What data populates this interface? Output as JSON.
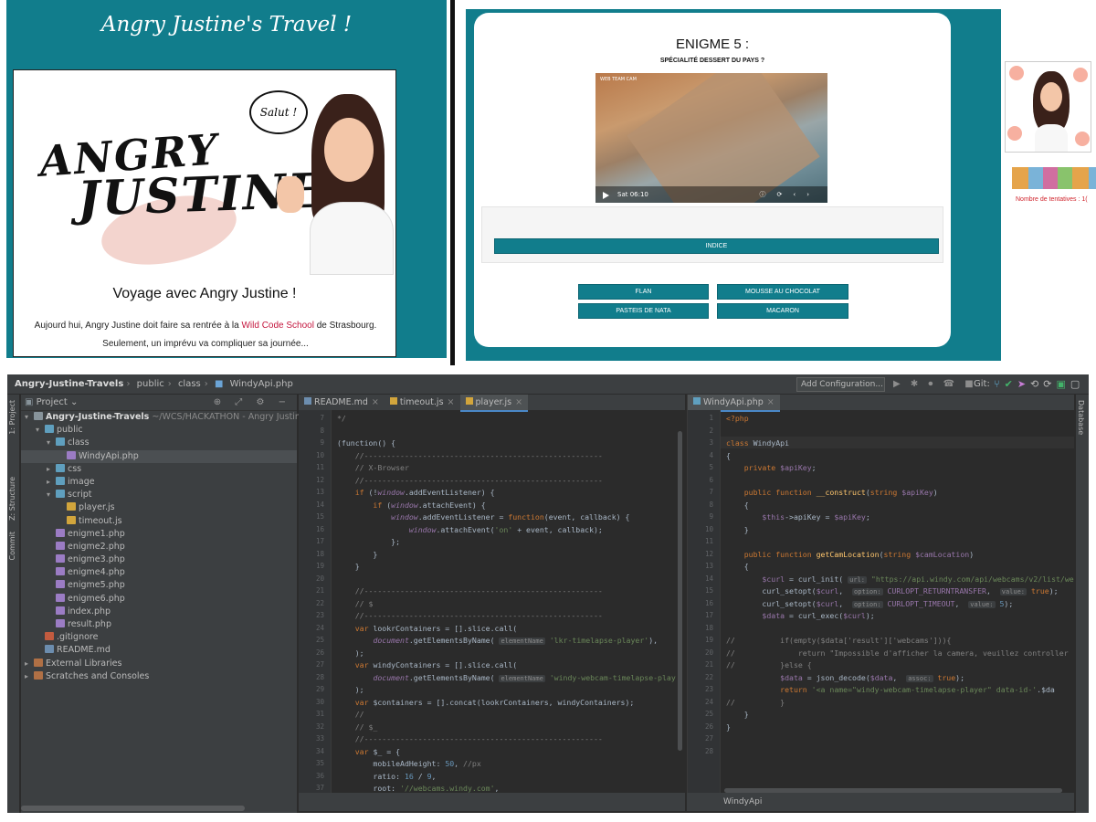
{
  "travel": {
    "title": "Angry Justine's Travel !",
    "logo_line1": "ANGRY",
    "logo_line2": "JUSTINE",
    "bubble": "Salut !",
    "heading": "Voyage avec Angry Justine !",
    "p1_a": "Aujourd hui, Angry Justine doit faire sa rentrée à la ",
    "p1_link": "Wild Code School",
    "p1_b": " de Strasbourg.",
    "p2": "Seulement, un imprévu va compliquer sa journée..."
  },
  "enigma": {
    "title": "ENIGME 5 :",
    "subtitle": "SPÉCIALITÉ DESSERT DU PAYS ?",
    "video_tag": "WEB TEAM CAM",
    "video_time": "Sat 06:10",
    "hint_button": "INDICE",
    "answers": [
      "FLAN",
      "MOUSSE AU CHOCOLAT",
      "PASTEIS DE NATA",
      "MACARON"
    ]
  },
  "sidebar": {
    "attempts": "Nombre de tentatives : 1("
  },
  "ide": {
    "breadcrumb": [
      "Angry-Justine-Travels",
      "public",
      "class",
      "WindyApi.php"
    ],
    "add_configuration": "Add Configuration...",
    "git_label": "Git:",
    "left_tabs": [
      "1: Project",
      "Z: Structure",
      "Commit"
    ],
    "right_tab": "Database",
    "project_header": "Project",
    "tree": [
      {
        "label": "Angry-Justine-Travels",
        "suffix": "~/WCS/HACKATHON - Angry Justine/An",
        "depth": 0,
        "arrow": "▾",
        "icon": "folder",
        "bold": true
      },
      {
        "label": "public",
        "depth": 1,
        "arrow": "▾",
        "icon": "folderb"
      },
      {
        "label": "class",
        "depth": 2,
        "arrow": "▾",
        "icon": "folderb"
      },
      {
        "label": "WindyApi.php",
        "depth": 3,
        "arrow": "",
        "icon": "php",
        "selected": true
      },
      {
        "label": "css",
        "depth": 2,
        "arrow": "▸",
        "icon": "folderb"
      },
      {
        "label": "image",
        "depth": 2,
        "arrow": "▸",
        "icon": "folderb"
      },
      {
        "label": "script",
        "depth": 2,
        "arrow": "▾",
        "icon": "folderb"
      },
      {
        "label": "player.js",
        "depth": 3,
        "arrow": "",
        "icon": "js"
      },
      {
        "label": "timeout.js",
        "depth": 3,
        "arrow": "",
        "icon": "js"
      },
      {
        "label": "enigme1.php",
        "depth": 2,
        "arrow": "",
        "icon": "php"
      },
      {
        "label": "enigme2.php",
        "depth": 2,
        "arrow": "",
        "icon": "php"
      },
      {
        "label": "enigme3.php",
        "depth": 2,
        "arrow": "",
        "icon": "php"
      },
      {
        "label": "enigme4.php",
        "depth": 2,
        "arrow": "",
        "icon": "php"
      },
      {
        "label": "enigme5.php",
        "depth": 2,
        "arrow": "",
        "icon": "php"
      },
      {
        "label": "enigme6.php",
        "depth": 2,
        "arrow": "",
        "icon": "php"
      },
      {
        "label": "index.php",
        "depth": 2,
        "arrow": "",
        "icon": "php"
      },
      {
        "label": "result.php",
        "depth": 2,
        "arrow": "",
        "icon": "php"
      },
      {
        "label": ".gitignore",
        "depth": 1,
        "arrow": "",
        "icon": "git"
      },
      {
        "label": "README.md",
        "depth": 1,
        "arrow": "",
        "icon": "md"
      },
      {
        "label": "External Libraries",
        "depth": 0,
        "arrow": "▸",
        "icon": "lib"
      },
      {
        "label": "Scratches and Consoles",
        "depth": 0,
        "arrow": "▸",
        "icon": "lib"
      }
    ],
    "editor1_tabs": [
      {
        "label": "README.md",
        "icon": "md",
        "active": false
      },
      {
        "label": "timeout.js",
        "icon": "js",
        "active": false
      },
      {
        "label": "player.js",
        "icon": "js",
        "active": true
      }
    ],
    "editor2_tabs": [
      {
        "label": "WindyApi.php",
        "icon": "php",
        "active": true
      }
    ],
    "editor1_start_line": 7,
    "editor1_lines": [
      [
        [
          "cm",
          "*/"
        ]
      ],
      [],
      [
        [
          "",
          "(function() {"
        ]
      ],
      [
        [
          "cm",
          "    //-----------------------------------------------------"
        ]
      ],
      [
        [
          "cm",
          "    // X-Browser"
        ]
      ],
      [
        [
          "cm",
          "    //-----------------------------------------------------"
        ]
      ],
      [
        [
          "kw",
          "    if "
        ],
        [
          "",
          "(!"
        ],
        [
          "gl",
          "window"
        ],
        [
          "",
          ".addEventListener) {"
        ]
      ],
      [
        [
          "kw",
          "        if "
        ],
        [
          "",
          "("
        ],
        [
          "gl",
          "window"
        ],
        [
          "",
          ".attachEvent) {"
        ]
      ],
      [
        [
          "",
          "            "
        ],
        [
          "gl",
          "window"
        ],
        [
          "",
          ".addEventListener = "
        ],
        [
          "kw",
          "function"
        ],
        [
          "",
          "(event, callback) {"
        ]
      ],
      [
        [
          "",
          "                "
        ],
        [
          "gl",
          "window"
        ],
        [
          "",
          ".attachEvent("
        ],
        [
          "st",
          "'on'"
        ],
        [
          "",
          " + event, callback);"
        ]
      ],
      [
        [
          "",
          "            };"
        ]
      ],
      [
        [
          "",
          "        }"
        ]
      ],
      [
        [
          "",
          "    }"
        ]
      ],
      [],
      [
        [
          "cm",
          "    //-----------------------------------------------------"
        ]
      ],
      [
        [
          "cm",
          "    // $"
        ]
      ],
      [
        [
          "cm",
          "    //-----------------------------------------------------"
        ]
      ],
      [
        [
          "kw",
          "    var "
        ],
        [
          "",
          "lookrContainers = [].slice.call("
        ]
      ],
      [
        [
          "",
          "        "
        ],
        [
          "gl",
          "document"
        ],
        [
          "",
          ".getElementsByName( "
        ],
        [
          "hint",
          "elementName"
        ],
        [
          "st",
          " 'lkr-timelapse-player'"
        ],
        [
          "",
          "),"
        ]
      ],
      [
        [
          "",
          "    );"
        ]
      ],
      [
        [
          "kw",
          "    var "
        ],
        [
          "",
          "windyContainers = [].slice.call("
        ]
      ],
      [
        [
          "",
          "        "
        ],
        [
          "gl",
          "document"
        ],
        [
          "",
          ".getElementsByName( "
        ],
        [
          "hint",
          "elementName"
        ],
        [
          "st",
          " 'windy-webcam-timelapse-play"
        ]
      ],
      [
        [
          "",
          "    );"
        ]
      ],
      [
        [
          "kw",
          "    var "
        ],
        [
          "",
          "$containers = [].concat(lookrContainers, windyContainers);"
        ]
      ],
      [
        [
          "cm",
          "    //"
        ]
      ],
      [
        [
          "cm",
          "    // $_"
        ]
      ],
      [
        [
          "cm",
          "    //-----------------------------------------------------"
        ]
      ],
      [
        [
          "kw",
          "    var "
        ],
        [
          "",
          "$_ = {"
        ]
      ],
      [
        [
          "",
          "        mobileAdHeight: "
        ],
        [
          "nm",
          "50"
        ],
        [
          "",
          ", "
        ],
        [
          "cm",
          "//px"
        ]
      ],
      [
        [
          "",
          "        ratio: "
        ],
        [
          "nm",
          "16"
        ],
        [
          "",
          " / "
        ],
        [
          "nm",
          "9"
        ],
        [
          "",
          ","
        ]
      ],
      [
        [
          "",
          "        root: "
        ],
        [
          "st",
          "'//webcams.windy.com'"
        ],
        [
          "",
          ","
        ]
      ],
      [
        [
          "",
          "    };"
        ]
      ]
    ],
    "editor2_start_line": 1,
    "editor2_lines": [
      [
        [
          "kw",
          "<?php"
        ]
      ],
      [],
      [
        [
          "kw",
          "class "
        ],
        [
          "",
          "WindyApi"
        ]
      ],
      [
        [
          "",
          "{"
        ]
      ],
      [
        [
          "kw",
          "    private "
        ],
        [
          "vr",
          "$apiKey"
        ],
        [
          "",
          ";"
        ]
      ],
      [],
      [
        [
          "kw",
          "    public function "
        ],
        [
          "fn",
          "__construct"
        ],
        [
          "",
          "("
        ],
        [
          "kw",
          "string "
        ],
        [
          "vr",
          "$apiKey"
        ],
        [
          "",
          ")"
        ]
      ],
      [
        [
          "",
          "    {"
        ]
      ],
      [
        [
          "vr",
          "        $this"
        ],
        [
          "",
          "->apiKey = "
        ],
        [
          "vr",
          "$apiKey"
        ],
        [
          "",
          ";"
        ]
      ],
      [
        [
          "",
          "    }"
        ]
      ],
      [],
      [
        [
          "kw",
          "    public function "
        ],
        [
          "fn",
          "getCamLocation"
        ],
        [
          "",
          "("
        ],
        [
          "kw",
          "string "
        ],
        [
          "vr",
          "$camLocation"
        ],
        [
          "",
          ")"
        ]
      ],
      [
        [
          "",
          "    {"
        ]
      ],
      [
        [
          "vr",
          "        $curl"
        ],
        [
          "",
          " = curl_init( "
        ],
        [
          "hint",
          "url:"
        ],
        [
          "st",
          " \"https://api.windy.com/api/webcams/v2/list/we"
        ]
      ],
      [
        [
          "",
          "        curl_setopt("
        ],
        [
          "vr",
          "$curl"
        ],
        [
          "",
          ",  "
        ],
        [
          "hint",
          "option:"
        ],
        [
          "vr",
          " CURLOPT_RETURNTRANSFER"
        ],
        [
          "",
          ",  "
        ],
        [
          "hint",
          "value:"
        ],
        [
          "kw",
          " true"
        ],
        [
          "",
          ");"
        ]
      ],
      [
        [
          "",
          "        curl_setopt("
        ],
        [
          "vr",
          "$curl"
        ],
        [
          "",
          ",  "
        ],
        [
          "hint",
          "option:"
        ],
        [
          "vr",
          " CURLOPT_TIMEOUT"
        ],
        [
          "",
          ",  "
        ],
        [
          "hint",
          "value:"
        ],
        [
          "nm",
          " 5"
        ],
        [
          "",
          ");"
        ]
      ],
      [
        [
          "vr",
          "        $data"
        ],
        [
          "",
          " = curl_exec("
        ],
        [
          "vr",
          "$curl"
        ],
        [
          "",
          ");"
        ]
      ],
      [],
      [
        [
          "cm",
          "//          if(empty($data['result']['webcams'])){"
        ]
      ],
      [
        [
          "cm",
          "//              return \"Impossible d'afficher la camera, veuillez controller"
        ]
      ],
      [
        [
          "cm",
          "//          }else {"
        ]
      ],
      [
        [
          "vr",
          "            $data"
        ],
        [
          "",
          " = json_decode("
        ],
        [
          "vr",
          "$data"
        ],
        [
          "",
          ",  "
        ],
        [
          "hint",
          "assoc:"
        ],
        [
          "kw",
          " true"
        ],
        [
          "",
          ");"
        ]
      ],
      [
        [
          "kw",
          "            return "
        ],
        [
          "st",
          "'<a name=\"windy-webcam-timelapse-player\" data-id-'"
        ],
        [
          "",
          ".$da"
        ]
      ],
      [
        [
          "cm",
          "//          }"
        ]
      ],
      [
        [
          "",
          "    }"
        ]
      ],
      [
        [
          "",
          "}"
        ]
      ],
      [],
      []
    ],
    "status_label": "WindyApi"
  },
  "colors": {
    "teal": "#117d8c",
    "accent_red": "#c4163e",
    "ide_bg": "#2b2b2b",
    "ide_panel": "#3c3f41"
  }
}
